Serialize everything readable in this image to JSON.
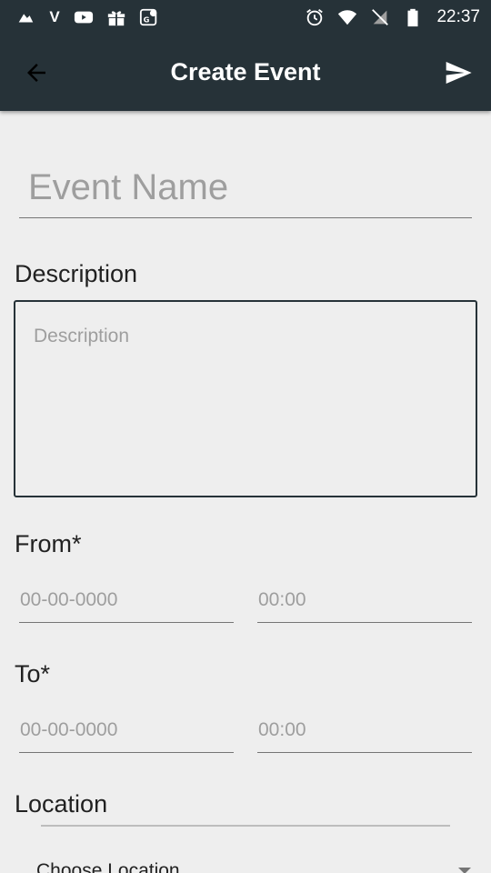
{
  "status_bar": {
    "carrier_glyph": "V",
    "time": "22:37",
    "left_icons": [
      "cloud-icon",
      "carrier-icon",
      "youtube-icon",
      "gift-icon",
      "maps-icon"
    ],
    "right_icons": [
      "alarm-icon",
      "wifi-icon",
      "no-signal-icon",
      "battery-icon"
    ]
  },
  "toolbar": {
    "title": "Create Event",
    "back_icon": "arrow-back-icon",
    "action_icon": "send-icon",
    "background": "#263238"
  },
  "form": {
    "event_name_placeholder": "Event Name",
    "description_label": "Description",
    "description_placeholder": "Description",
    "from_label": "From*",
    "from_date_placeholder": "00-00-0000",
    "from_time_placeholder": "00:00",
    "to_label": "To*",
    "to_date_placeholder": "00-00-0000",
    "to_time_placeholder": "00:00",
    "location_label": "Location",
    "location_select": "Choose Location"
  }
}
